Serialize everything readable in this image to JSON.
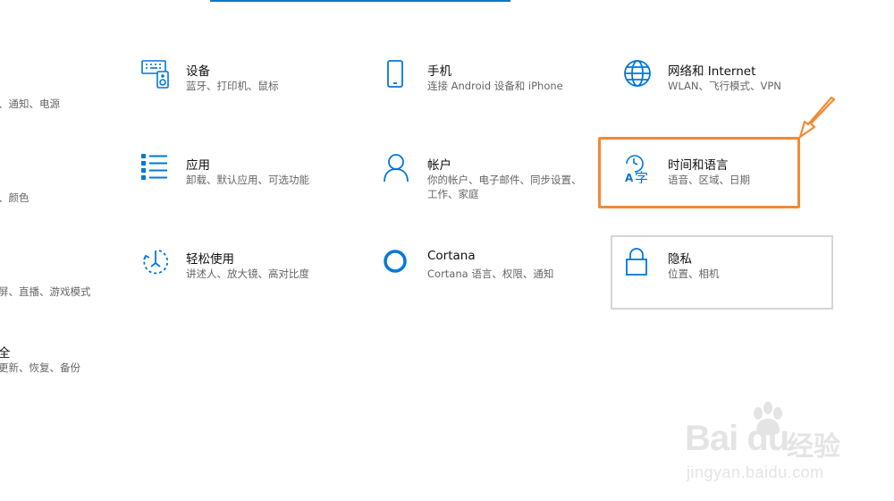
{
  "tiles": {
    "system_partial": {
      "title": "",
      "desc": "、通知、电源"
    },
    "devices": {
      "title": "设备",
      "desc": "蓝牙、打印机、鼠标",
      "icon": "keyboard-device-icon"
    },
    "phone": {
      "title": "手机",
      "desc": "连接 Android 设备和 iPhone",
      "icon": "phone-icon"
    },
    "network": {
      "title": "网络和 Internet",
      "desc": "WLAN、飞行模式、VPN",
      "icon": "globe-icon"
    },
    "personalization_partial": {
      "title": "",
      "desc": "、颜色"
    },
    "apps": {
      "title": "应用",
      "desc": "卸载、默认应用、可选功能",
      "icon": "apps-list-icon"
    },
    "accounts": {
      "title": "帐户",
      "desc": "你的帐户、电子邮件、同步设置、工作、家庭",
      "icon": "person-icon"
    },
    "time_language": {
      "title": "时间和语言",
      "desc": "语音、区域、日期",
      "icon": "time-language-icon"
    },
    "gaming_partial": {
      "title": "",
      "desc": "屏、直播、游戏模式"
    },
    "ease_of_access": {
      "title": "轻松使用",
      "desc": "讲述人、放大镜、高对比度",
      "icon": "ease-of-access-icon"
    },
    "cortana": {
      "title": "Cortana",
      "desc": "Cortana 语言、权限、通知",
      "icon": "cortana-circle-icon"
    },
    "privacy": {
      "title": "隐私",
      "desc": "位置、相机",
      "icon": "lock-icon"
    },
    "update_partial": {
      "title": "全",
      "desc": "更新、恢复、备份"
    }
  },
  "watermark": {
    "brand": "Bai du",
    "brand_cn": "经验",
    "url": "jingyan.baidu.com"
  },
  "colors": {
    "accent": "#0078d7",
    "highlight": "#f28a35",
    "hover_border": "#d6d6d6"
  }
}
